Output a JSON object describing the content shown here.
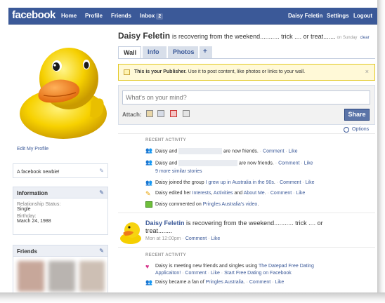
{
  "topbar": {
    "logo": "facebook",
    "nav": [
      "Home",
      "Profile",
      "Friends"
    ],
    "inbox_label": "Inbox",
    "inbox_count": "2",
    "user": "Daisy Feletin",
    "settings": "Settings",
    "logout": "Logout"
  },
  "left": {
    "edit_profile": "Edit My Profile",
    "bio": "A facebook newbie!",
    "information": {
      "title": "Information",
      "relationship_label": "Relationship Status:",
      "relationship_value": "Single",
      "birthday_label": "Birthday:",
      "birthday_value": "March 24, 1988"
    },
    "friends_title": "Friends"
  },
  "header": {
    "name": "Daisy Feletin",
    "status": "is recovering from the weekend........... trick .... or treat.......",
    "status_time": "on Sunday",
    "clear": "clear"
  },
  "tabs": [
    "Wall",
    "Info",
    "Photos",
    "+"
  ],
  "publisher": {
    "tip_bold": "This is your Publisher.",
    "tip_text": " Use it to post content, like photos or links to your wall.",
    "close": "×",
    "placeholder": "What's on your mind?",
    "attach_label": "Attach:",
    "share": "Share",
    "options": "Options"
  },
  "recent_activity_1": {
    "title": "RECENT ACTIVITY",
    "rows": [
      {
        "pre": "Daisy and",
        "post": "are now friends.",
        "meta": " · ",
        "comment": "Comment",
        "like": "Like"
      },
      {
        "pre": "Daisy and",
        "post": "are now friends.",
        "meta": " · ",
        "comment": "Comment",
        "like": "Like"
      },
      {
        "link": "9 more similar stories"
      },
      {
        "pre": "Daisy joined the group ",
        "link": "I grew up in Australia in the 90s",
        "post": ".",
        "comment": "Comment",
        "like": "Like"
      },
      {
        "pre": "Daisy edited her ",
        "link": "Interests",
        "mid": ", ",
        "link2": "Activities",
        "mid2": " and ",
        "link3": "About Me",
        "post": ".",
        "comment": "Comment",
        "like": "Like"
      },
      {
        "pre": "Daisy commented on ",
        "link": "Pringles Australia's video",
        "post": "."
      }
    ]
  },
  "post": {
    "author": "Daisy Feletin",
    "text": " is recovering from the weekend........... trick .... or treat........",
    "time": "Mon at 12:00pm",
    "comment": "Comment",
    "like": "Like"
  },
  "recent_activity_2": {
    "title": "RECENT ACTIVITY",
    "row1_pre": "Daisy is meeting new friends and singles using ",
    "row1_link": "The Datepad Free Dating",
    "row1_link_cont": "Applicaiton!",
    "row2_pre": "Daisy became a fan of ",
    "row2_link": "Pringles Australia",
    "comment": "Comment",
    "like": "Like",
    "start_dating": "Start Free Dating on Facebook"
  },
  "colors": {
    "brand": "#3b5998",
    "tip_bg": "#fff9d7",
    "share": "#5b74a8"
  }
}
